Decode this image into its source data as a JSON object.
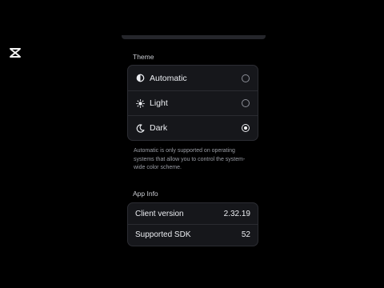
{
  "theme": {
    "header": "Theme",
    "options": [
      {
        "label": "Automatic",
        "icon": "half-circle-icon",
        "selected": false
      },
      {
        "label": "Light",
        "icon": "sun-icon",
        "selected": false
      },
      {
        "label": "Dark",
        "icon": "moon-icon",
        "selected": true
      }
    ],
    "help_text": "Automatic is only supported on operating systems that allow you to control the system-wide color scheme."
  },
  "app_info": {
    "header": "App Info",
    "rows": [
      {
        "label": "Client version",
        "value": "2.32.19"
      },
      {
        "label": "Supported SDK",
        "value": "52"
      }
    ]
  },
  "colors": {
    "background": "#000000",
    "card": "#16171b",
    "border": "#2c2d33",
    "text": "#eceef2",
    "muted_text": "#9a9da5"
  }
}
